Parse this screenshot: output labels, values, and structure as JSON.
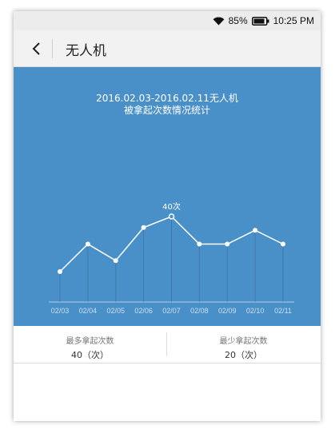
{
  "status_bar": {
    "battery_percent": "85%",
    "time": "10:25 PM",
    "icons": [
      "wifi-icon",
      "battery-icon"
    ]
  },
  "header": {
    "title": "无人机",
    "back_icon": "chevron-left-icon"
  },
  "chart": {
    "title_line1": "2016.02.03-2016.02.11无人机",
    "title_line2": "被拿起次数情况统计"
  },
  "chart_data": {
    "type": "line",
    "title": "2016.02.03-2016.02.11无人机 被拿起次数情况统计",
    "categories": [
      "02/03",
      "02/04",
      "02/05",
      "02/06",
      "02/07",
      "02/08",
      "02/09",
      "02/10",
      "02/11"
    ],
    "series": [
      {
        "values": [
          20,
          30,
          24,
          36,
          40,
          30,
          30,
          35,
          30
        ]
      }
    ],
    "annotations": [
      {
        "category": "02/07",
        "text": "40次"
      }
    ],
    "ylim": [
      0,
      48
    ],
    "colors": {
      "background": "#4a90c8",
      "line": "#ffffff"
    }
  },
  "stats": {
    "max_label": "最多拿起次数",
    "max_value": "40（次）",
    "min_label": "最少拿起次数",
    "min_value": "20（次）"
  }
}
